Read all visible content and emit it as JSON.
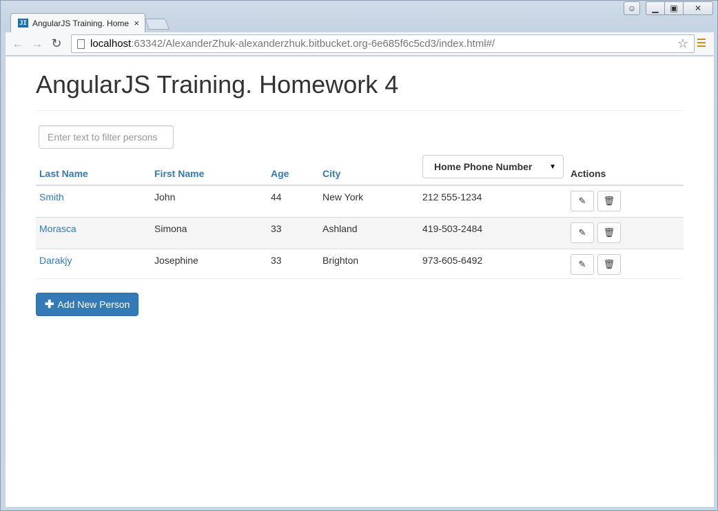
{
  "browser": {
    "tab_title": "AngularJS Training. Home",
    "tab_favicon": "JI",
    "url_host": "localhost",
    "url_rest": ":63342/AlexanderZhuk-alexanderzhuk.bitbucket.org-6e685f6c5cd3/index.html#/",
    "icons": [
      "back-arrow-icon",
      "forward-arrow-icon",
      "reload-icon",
      "page-icon",
      "star-icon",
      "menu-icon",
      "close-icon"
    ]
  },
  "page": {
    "title": "AngularJS Training. Homework 4",
    "filter_placeholder": "Enter text to filter persons",
    "columns": {
      "last_name": "Last Name",
      "first_name": "First Name",
      "age": "Age",
      "city": "City",
      "phone_select": "Home Phone Number",
      "actions": "Actions"
    },
    "rows": [
      {
        "last": "Smith",
        "first": "John",
        "age": "44",
        "city": "New York",
        "phone": "212 555-1234"
      },
      {
        "last": "Morasca",
        "first": "Simona",
        "age": "33",
        "city": "Ashland",
        "phone": "419-503-2484"
      },
      {
        "last": "Darakjy",
        "first": "Josephine",
        "age": "33",
        "city": "Brighton",
        "phone": "973-605-6492"
      }
    ],
    "add_button": "Add New Person",
    "colors": {
      "link": "#337ab7",
      "primary": "#337ab7"
    }
  }
}
